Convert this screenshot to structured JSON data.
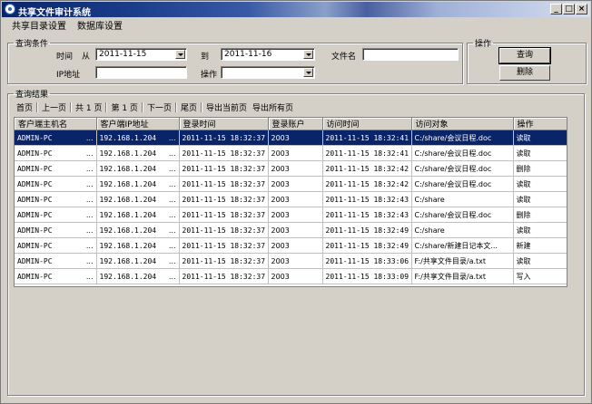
{
  "window": {
    "title": "共享文件审计系统",
    "min": "_",
    "max": "□",
    "close": "×"
  },
  "menu": [
    "共享目录设置",
    "数据库设置"
  ],
  "query": {
    "legend": "查询条件",
    "time_label": "时间",
    "from_label": "从",
    "from_value": "2011-11-15",
    "to_label": "到",
    "to_value": "2011-11-16",
    "filename_label": "文件名",
    "filename_value": "",
    "ip_label": "IP地址",
    "ip_value": "",
    "op_label": "操作",
    "op_value": ""
  },
  "ops": {
    "legend": "操作",
    "query_button": "查询",
    "delete_button": "删除"
  },
  "results": {
    "legend": "查询结果",
    "pager": [
      "首页",
      "上一页",
      "共 1 页",
      "第 1 页",
      "下一页",
      "尾页",
      "导出当前页",
      "导出所有页"
    ],
    "columns": [
      "客户端主机名",
      "客户端IP地址",
      "登录时间",
      "登录账户",
      "访问时间",
      "访问对象",
      "操作"
    ],
    "rows": [
      [
        "ADMIN-PC",
        "192.168.1.204",
        "2011-11-15 18:32:37",
        "2003",
        "2011-11-15 18:32:41",
        "C:/share/会议日程.doc",
        "读取"
      ],
      [
        "ADMIN-PC",
        "192.168.1.204",
        "2011-11-15 18:32:37",
        "2003",
        "2011-11-15 18:32:41",
        "C:/share/会议日程.doc",
        "读取"
      ],
      [
        "ADMIN-PC",
        "192.168.1.204",
        "2011-11-15 18:32:37",
        "2003",
        "2011-11-15 18:32:42",
        "C:/share/会议日程.doc",
        "删除"
      ],
      [
        "ADMIN-PC",
        "192.168.1.204",
        "2011-11-15 18:32:37",
        "2003",
        "2011-11-15 18:32:42",
        "C:/share/会议日程.doc",
        "读取"
      ],
      [
        "ADMIN-PC",
        "192.168.1.204",
        "2011-11-15 18:32:37",
        "2003",
        "2011-11-15 18:32:43",
        "C:/share",
        "读取"
      ],
      [
        "ADMIN-PC",
        "192.168.1.204",
        "2011-11-15 18:32:37",
        "2003",
        "2011-11-15 18:32:43",
        "C:/share/会议日程.doc",
        "删除"
      ],
      [
        "ADMIN-PC",
        "192.168.1.204",
        "2011-11-15 18:32:37",
        "2003",
        "2011-11-15 18:32:49",
        "C:/share",
        "读取"
      ],
      [
        "ADMIN-PC",
        "192.168.1.204",
        "2011-11-15 18:32:37",
        "2003",
        "2011-11-15 18:32:49",
        "C:/share/新建日记本文...",
        "新建"
      ],
      [
        "ADMIN-PC",
        "192.168.1.204",
        "2011-11-15 18:32:37",
        "2003",
        "2011-11-15 18:33:06",
        "F:/共享文件目录/a.txt",
        "读取"
      ],
      [
        "ADMIN-PC",
        "192.168.1.204",
        "2011-11-15 18:32:37",
        "2003",
        "2011-11-15 18:33:09",
        "F:/共享文件目录/a.txt",
        "写入"
      ]
    ]
  },
  "colors": {
    "selection": "#0a246a",
    "face": "#d4d0c8"
  }
}
